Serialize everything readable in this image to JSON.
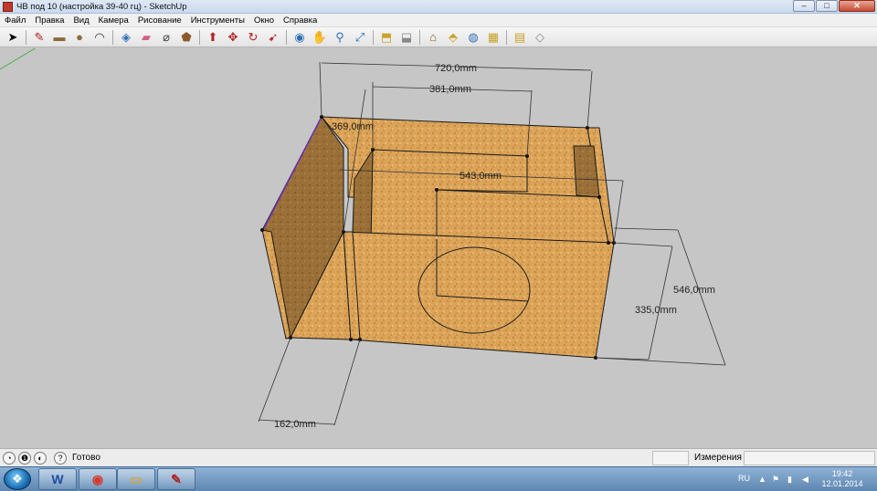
{
  "window": {
    "title": "ЧВ под 10 (настройка 39-40 гц) - SketchUp",
    "minimize": "–",
    "maximize": "□",
    "close": "✕"
  },
  "menu": [
    "Файл",
    "Правка",
    "Вид",
    "Камера",
    "Рисование",
    "Инструменты",
    "Окно",
    "Справка"
  ],
  "toolbar": {
    "tools": [
      {
        "name": "select-tool",
        "glyph": "➤",
        "color": "#000000"
      },
      {
        "name": "line-tool",
        "glyph": "✎",
        "color": "#b22222"
      },
      {
        "name": "rectangle-tool",
        "glyph": "▬",
        "color": "#8b6b3d"
      },
      {
        "name": "circle-tool",
        "glyph": "●",
        "color": "#8b6b3d"
      },
      {
        "name": "arc-tool",
        "glyph": "◠",
        "color": "#333333"
      },
      {
        "name": "make-component-tool",
        "glyph": "◈",
        "color": "#2f6fb5"
      },
      {
        "name": "eraser-tool",
        "glyph": "▰",
        "color": "#d95b8a"
      },
      {
        "name": "tape-measure-tool",
        "glyph": "⌀",
        "color": "#444444"
      },
      {
        "name": "paint-bucket-tool",
        "glyph": "⬟",
        "color": "#8a5a2b"
      },
      {
        "name": "push-pull-tool",
        "glyph": "⬆",
        "color": "#b22222"
      },
      {
        "name": "move-tool",
        "glyph": "✥",
        "color": "#b22222"
      },
      {
        "name": "rotate-tool",
        "glyph": "↻",
        "color": "#b22222"
      },
      {
        "name": "follow-me-tool",
        "glyph": "➹",
        "color": "#b22222"
      },
      {
        "name": "orbit-tool",
        "glyph": "◉",
        "color": "#2f6fb5"
      },
      {
        "name": "pan-tool",
        "glyph": "✋",
        "color": "#444444"
      },
      {
        "name": "zoom-tool",
        "glyph": "⚲",
        "color": "#2f6fb5"
      },
      {
        "name": "zoom-extents-tool",
        "glyph": "⤢",
        "color": "#2f6fb5"
      },
      {
        "name": "previous-view-tool",
        "glyph": "⬒",
        "color": "#c9a227"
      },
      {
        "name": "next-view-tool",
        "glyph": "⬓",
        "color": "#888888"
      },
      {
        "name": "3d-warehouse-tool",
        "glyph": "⌂",
        "color": "#8a5a2b"
      },
      {
        "name": "share-model-tool",
        "glyph": "⬘",
        "color": "#c9a227"
      },
      {
        "name": "google-earth-tool",
        "glyph": "◍",
        "color": "#2f6fb5"
      },
      {
        "name": "get-models-tool",
        "glyph": "▦",
        "color": "#c9a227"
      },
      {
        "name": "components-tool",
        "glyph": "▤",
        "color": "#c9a227"
      },
      {
        "name": "extension-tool",
        "glyph": "◇",
        "color": "#888888"
      }
    ]
  },
  "dimensions": {
    "width": "720,0mm",
    "inner_width": "381,0mm",
    "top_depth": "369,0mm",
    "inner_depth": "543,0mm",
    "full_height": "546,0mm",
    "height": "335,0mm",
    "front_offset": "162,0mm"
  },
  "status": {
    "text": "Готово",
    "measurements_label": "Измерения",
    "help_icon": "?"
  },
  "taskbar": {
    "apps": [
      {
        "name": "word-taskbar-icon",
        "glyph": "W",
        "color": "#1f4e9c"
      },
      {
        "name": "chrome-taskbar-icon",
        "glyph": "◉",
        "color": "#d33b2c"
      },
      {
        "name": "explorer-taskbar-icon",
        "glyph": "▭",
        "color": "#d8a537"
      },
      {
        "name": "sketchup-taskbar-icon",
        "glyph": "✎",
        "color": "#b22222"
      }
    ],
    "language": "RU",
    "time": "19:42",
    "date": "12.01.2014"
  },
  "colors": {
    "wood": "#d9a35a",
    "wood_dark": "#a87a3c",
    "edge": "#1a1a1a",
    "viewport": "#c6c6c6"
  }
}
